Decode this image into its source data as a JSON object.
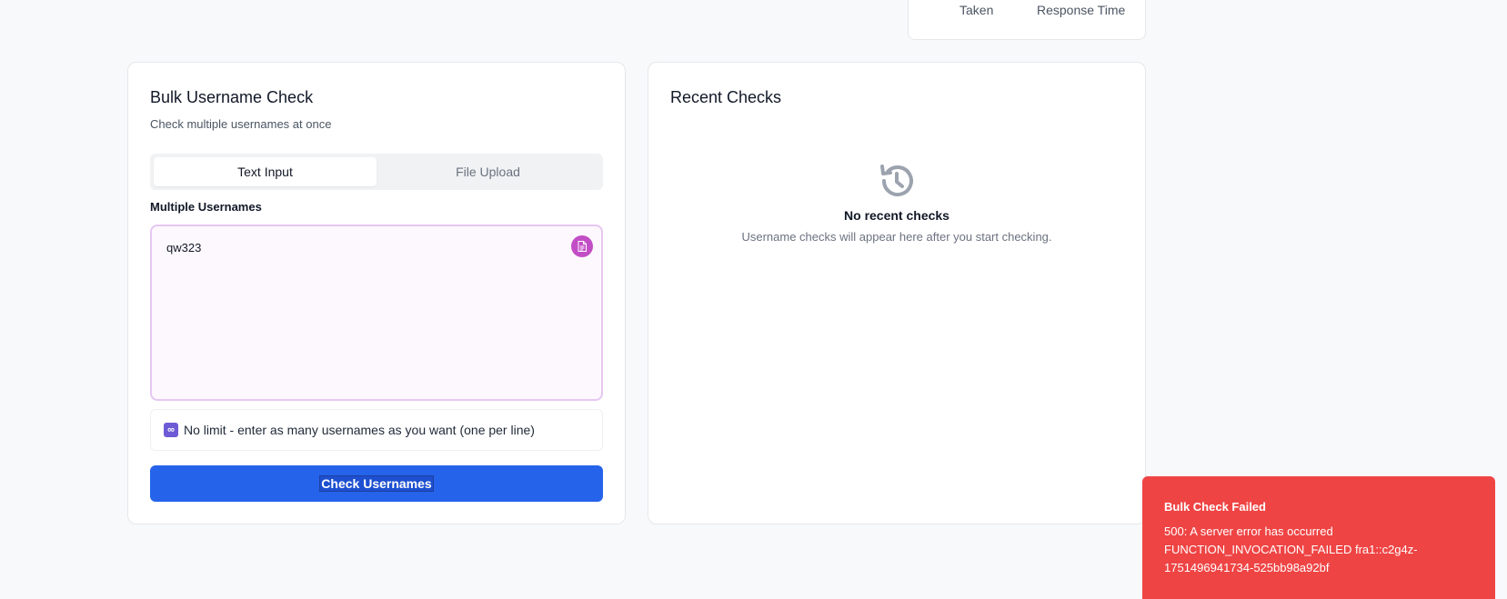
{
  "stats": {
    "taken_label": "Taken",
    "response_time_label": "Response Time"
  },
  "bulk": {
    "title": "Bulk Username Check",
    "subtitle": "Check multiple usernames at once",
    "tabs": [
      {
        "label": "Text Input",
        "active": true
      },
      {
        "label": "File Upload",
        "active": false
      }
    ],
    "field_label": "Multiple Usernames",
    "textarea_value": "qw323",
    "limit_icon": "infinity-icon",
    "limit_note": "No limit - enter as many usernames as you want (one per line)",
    "submit_label": "Check Usernames"
  },
  "recent": {
    "title": "Recent Checks",
    "empty_icon": "history-icon",
    "empty_title": "No recent checks",
    "empty_desc": "Username checks will appear here after you start checking."
  },
  "toast": {
    "title": "Bulk Check Failed",
    "message_line1": "500: A server error has occurred",
    "message_line2": "FUNCTION_INVOCATION_FAILED fra1::c2g4z-",
    "message_line3": "1751496941734-525bb98a92bf"
  },
  "colors": {
    "primary": "#2563eb",
    "error": "#ef4444",
    "accent": "#c24ec5",
    "textarea_border": "#e6c7f2"
  }
}
